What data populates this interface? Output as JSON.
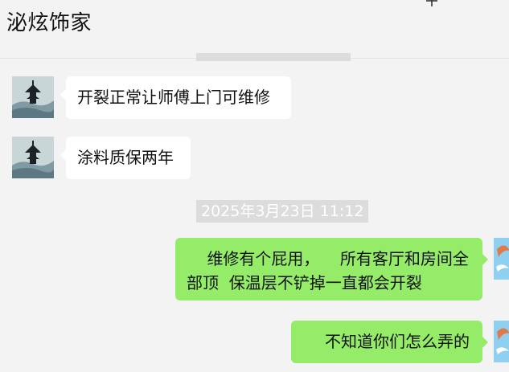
{
  "header": {
    "title": "泌炫饰家"
  },
  "icons": {
    "more": "plus-icon",
    "contact_avatar": "pagoda-landscape-avatar",
    "self_avatar": "bird-avatar"
  },
  "messages": [
    {
      "side": "in",
      "text": "开裂正常让师傅上门可维修"
    },
    {
      "side": "in",
      "text": "涂料质保两年"
    },
    {
      "side": "out",
      "text": "    维修有个屁用，    所有客厅和房间全部顶  保温层不铲掉一直都会开裂"
    },
    {
      "side": "out",
      "text": "不知道你们怎么弄的"
    }
  ],
  "timestamp": "2025年3月23日 11:12",
  "colors": {
    "background": "#f3f3f3",
    "incoming_bubble": "#ffffff",
    "outgoing_bubble": "#95ec69",
    "timestamp_bg": "#dcdcdc"
  }
}
